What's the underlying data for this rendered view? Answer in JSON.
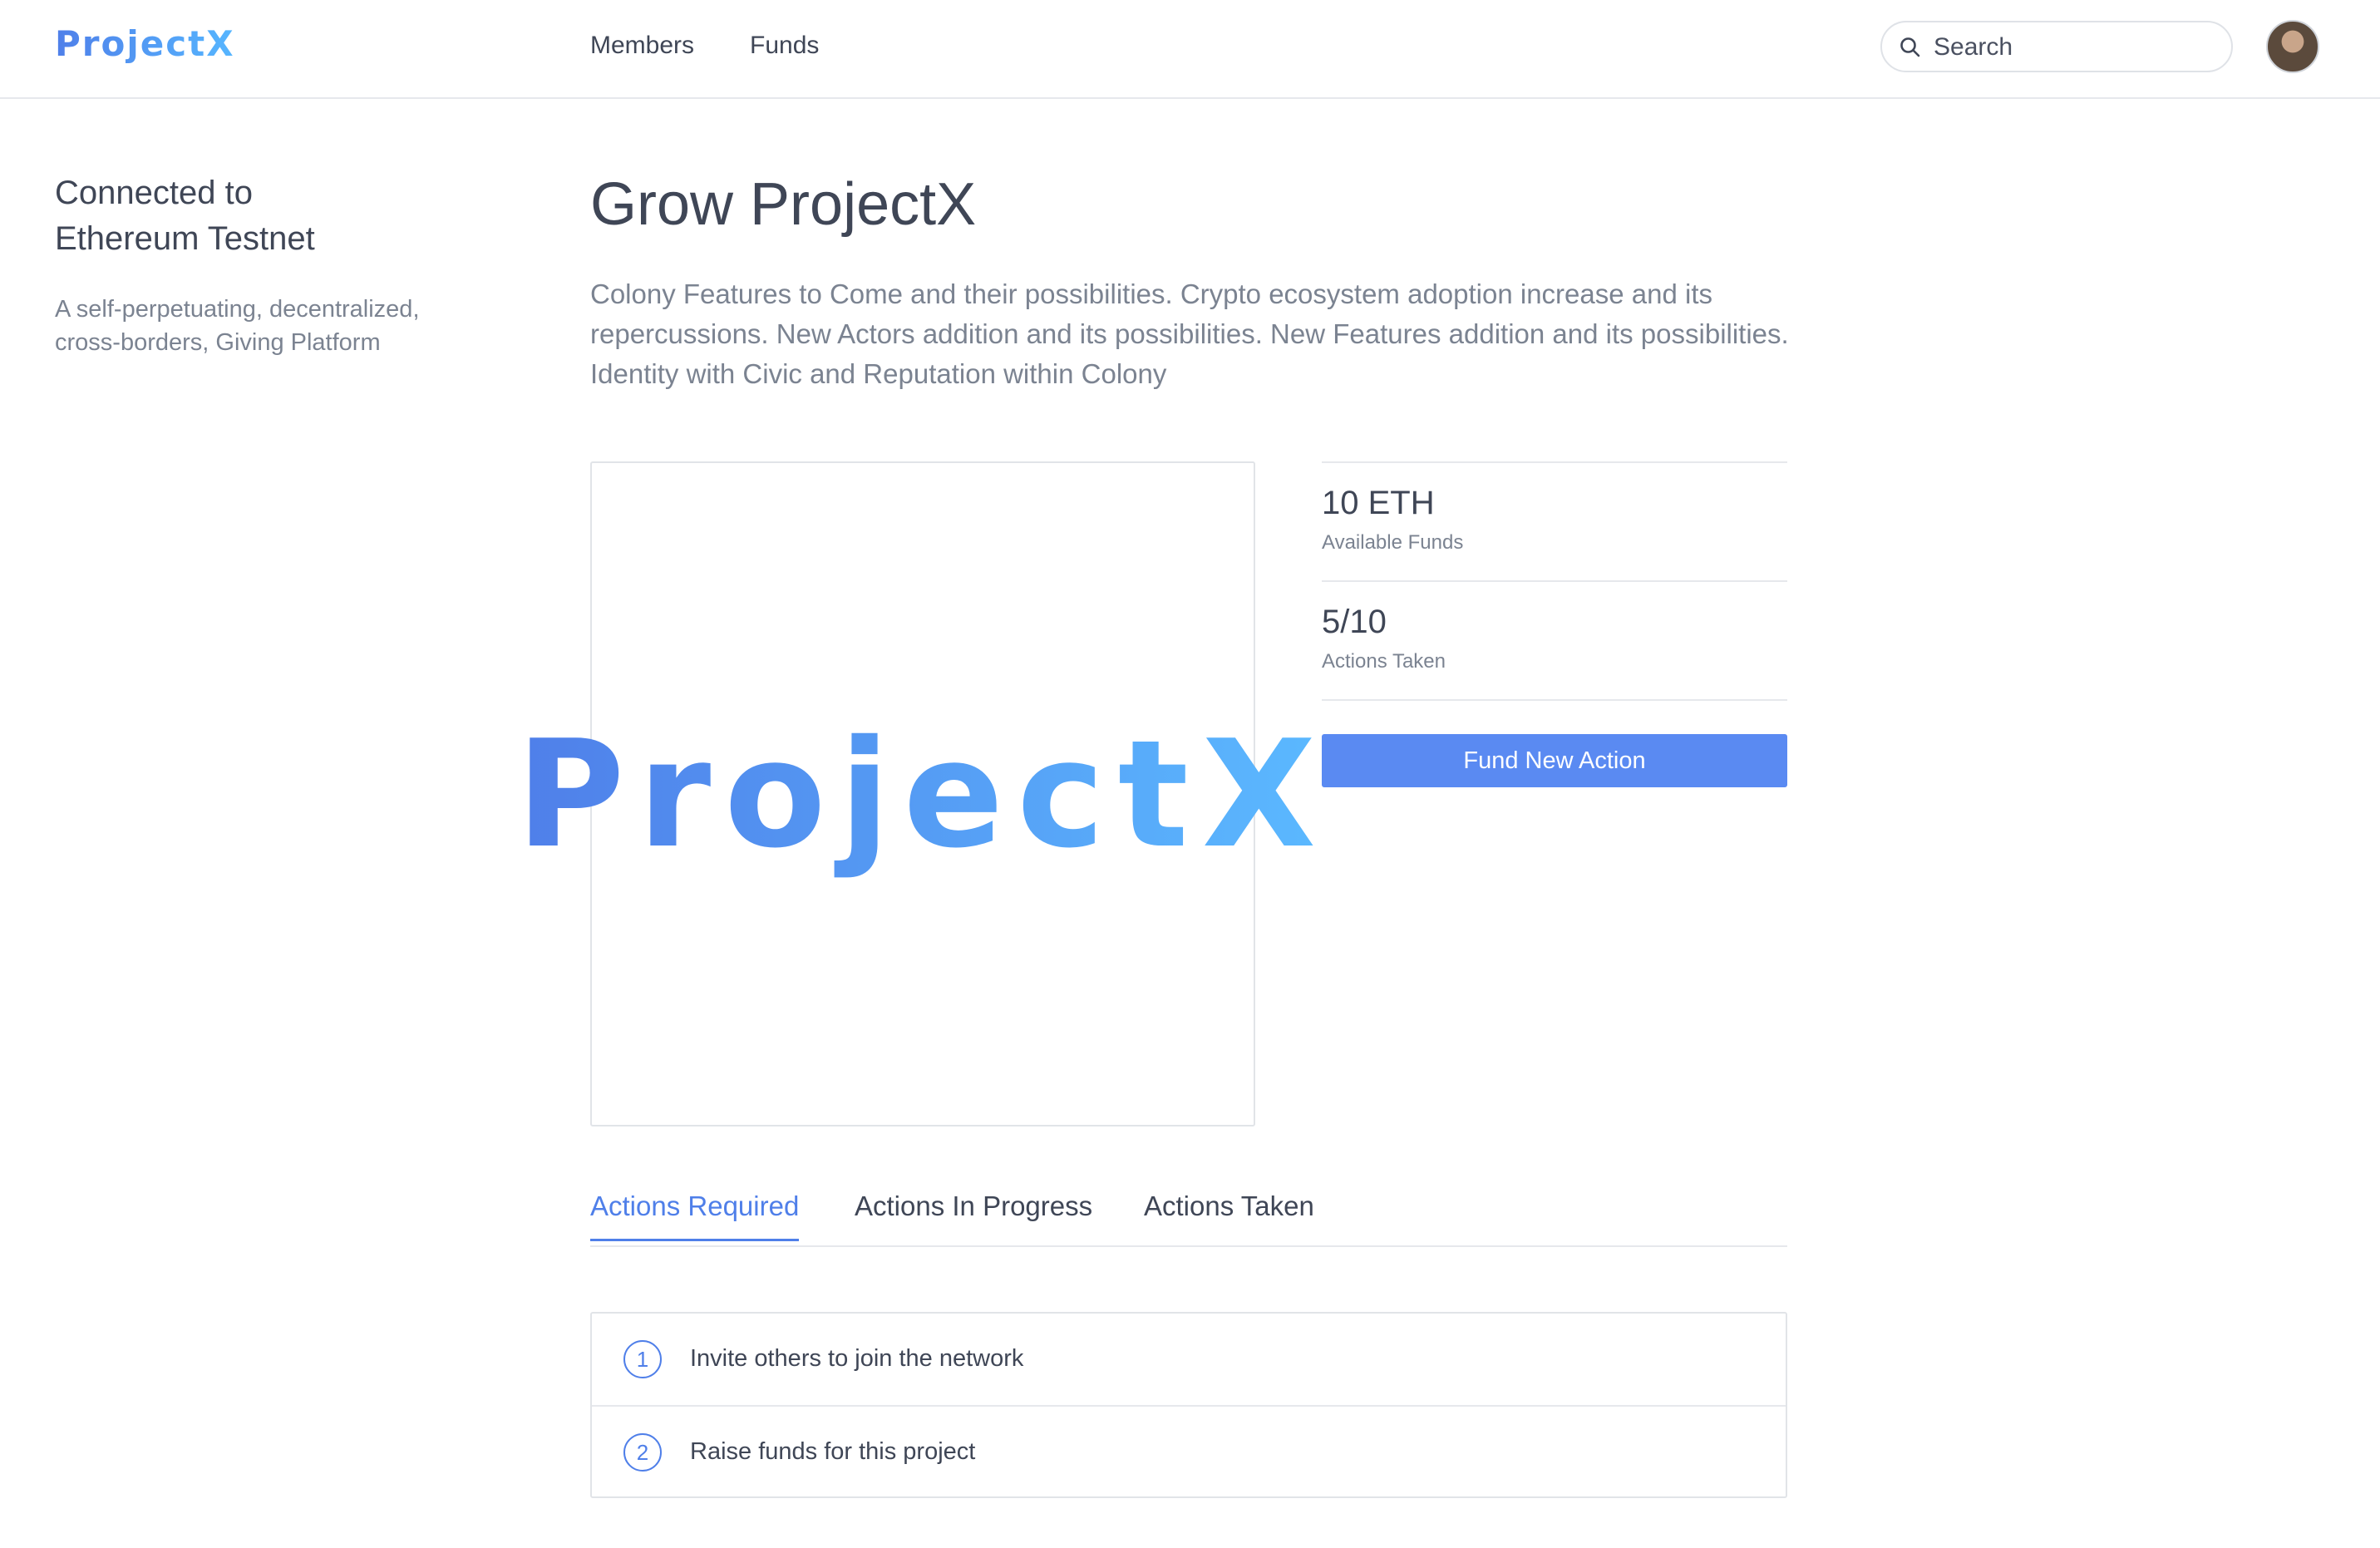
{
  "header": {
    "brand": "ProjectX",
    "nav": [
      {
        "label": "Members"
      },
      {
        "label": "Funds"
      }
    ],
    "search": {
      "placeholder": "Search",
      "value": ""
    },
    "accent_color": "#5a8af2"
  },
  "sidebar": {
    "title": "Connected to Ethereum Testnet",
    "description": "A self-perpetuating, decentralized, cross-borders, Giving Platform"
  },
  "main": {
    "title": "Grow ProjectX",
    "lead": "Colony Features to Come and their possibilities. Crypto ecosystem adoption increase and its repercussions. New Actors addition and its possibilities. New Features addition and its possibilities. Identity with Civic and Reputation within Colony",
    "logo_text": "ProjectX",
    "stats": [
      {
        "value": "10 ETH",
        "label": "Available Funds"
      },
      {
        "value": "5/10",
        "label": "Actions Taken"
      }
    ],
    "fund_button": "Fund New Action",
    "tabs": [
      {
        "label": "Actions Required",
        "active": true
      },
      {
        "label": "Actions In Progress",
        "active": false
      },
      {
        "label": "Actions Taken",
        "active": false
      }
    ],
    "actions": [
      {
        "number": "1",
        "text": "Invite others to join the network"
      },
      {
        "number": "2",
        "text": "Raise funds for this project"
      }
    ]
  }
}
